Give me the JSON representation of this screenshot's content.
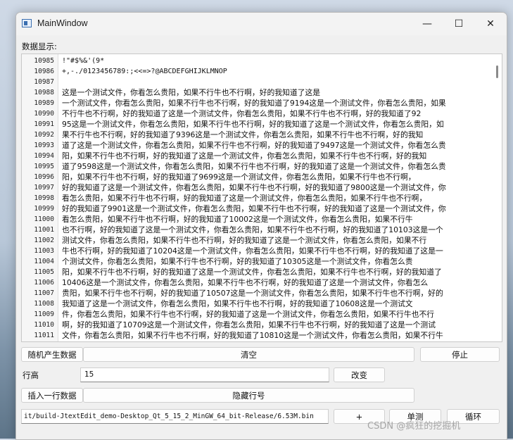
{
  "window": {
    "title": "MainWindow"
  },
  "titlebar": {
    "minimize_glyph": "—",
    "maximize_glyph": "☐",
    "close_glyph": "✕"
  },
  "labels": {
    "data_display": "数据显示:",
    "row_height": "行高"
  },
  "editor": {
    "line_numbers": [
      "10985",
      "10986",
      "10987",
      "10988",
      "10989",
      "10990",
      "10991",
      "10992",
      "10993",
      "10994",
      "10995",
      "10996",
      "10997",
      "10998",
      "10999",
      "11000",
      "11001",
      "11002",
      "11003",
      "11004",
      "11005",
      "11006",
      "11007",
      "11008",
      "11009",
      "11010",
      "11011"
    ],
    "lines": [
      "         !\"#$%&'(9*",
      "+,-./0123456789:;<<=>?@ABCDEFGHIJKLMNOP",
      "",
      "        这是一个测试文件，你看怎么贵阳，如果不行牛也不行啊，好的我知道了这是",
      "一个测试文件，你看怎么贵阳，如果不行牛也不行啊，好的我知道了9194这是一个测试文件，你看怎么贵阳，如果",
      "不行牛也不行啊，好的我知道了这是一个测试文件，你看怎么贵阳，如果不行牛也不行啊，好的我知道了92",
      "95这是一个测试文件，你看怎么贵阳，如果不行牛也不行啊，好的我知道了这是一个测试文件，你看怎么贵阳，如",
      "果不行牛也不行啊，好的我知道了9396这是一个测试文件，你看怎么贵阳，如果不行牛也不行啊，好的我知",
      "道了这是一个测试文件，你看怎么贵阳，如果不行牛也不行啊，好的我知道了9497这是一个测试文件，你看怎么贵",
      "阳，如果不行牛也不行啊，好的我知道了这是一个测试文件，你看怎么贵阳，如果不行牛也不行啊，好的我知",
      "道了9598这是一个测试文件，你看怎么贵阳，如果不行牛也不行啊，好的我知道了这是一个测试文件，你看怎么贵",
      "阳，如果不行牛也不行啊，好的我知道了9699这是一个测试文件，你看怎么贵阳，如果不行牛也不行啊，",
      "好的我知道了这是一个测试文件，你看怎么贵阳，如果不行牛也不行啊，好的我知道了9800这是一个测试文件，你",
      "看怎么贵阳，如果不行牛也不行啊，好的我知道了这是一个测试文件，你看怎么贵阳，如果不行牛也不行啊，",
      "好的我知道了9901这是一个测试文件，你看怎么贵阳，如果不行牛也不行啊，好的我知道了这是一个测试文件，你",
      "看怎么贵阳，如果不行牛也不行啊，好的我知道了10002这是一个测试文件，你看怎么贵阳，如果不行牛",
      "也不行啊，好的我知道了这是一个测试文件，你看怎么贵阳，如果不行牛也不行啊，好的我知道了10103这是一个",
      "测试文件，你看怎么贵阳，如果不行牛也不行啊，好的我知道了这是一个测试文件，你看怎么贵阳，如果不行",
      "牛也不行啊，好的我知道了10204这是一个测试文件，你看怎么贵阳，如果不行牛也不行啊，好的我知道了这是一",
      "个测试文件，你看怎么贵阳，如果不行牛也不行啊，好的我知道了10305这是一个测试文件，你看怎么贵",
      "阳，如果不行牛也不行啊，好的我知道了这是一个测试文件，你看怎么贵阳，如果不行牛也不行啊，好的我知道了",
      "10406这是一个测试文件，你看怎么贵阳，如果不行牛也不行啊，好的我知道了这是一个测试文件，你看怎么",
      "贵阳，如果不行牛也不行啊，好的我知道了10507这是一个测试文件，你看怎么贵阳，如果不行牛也不行啊，好的",
      "我知道了这是一个测试文件，你看怎么贵阳，如果不行牛也不行啊，好的我知道了10608这是一个测试文",
      "件，你看怎么贵阳，如果不行牛也不行啊，好的我知道了这是一个测试文件，你看怎么贵阳，如果不行牛也不行",
      "啊，好的我知道了10709这是一个测试文件，你看怎么贵阳，如果不行牛也不行啊，好的我知道了这是一个测试",
      "文件，你看怎么贵阳，如果不行牛也不行啊，好的我知道了10810这是一个测试文件，你看怎么贵阳，如果不行牛"
    ]
  },
  "buttons": {
    "random_generate": "随机产生数据",
    "clear": "清空",
    "stop": "停止",
    "change": "改变",
    "insert_row": "插入一行数据",
    "hide_line_numbers": "隐藏行号",
    "plus": "+",
    "single_loop": "单测",
    "loop": "循环"
  },
  "inputs": {
    "row_height_value": "15",
    "file_path": "it/build-JtextEdit_demo-Desktop_Qt_5_15_2_MinGW_64_bit-Release/6.53M.bin"
  },
  "watermark": "CSDN @疯狂的挖掘机"
}
